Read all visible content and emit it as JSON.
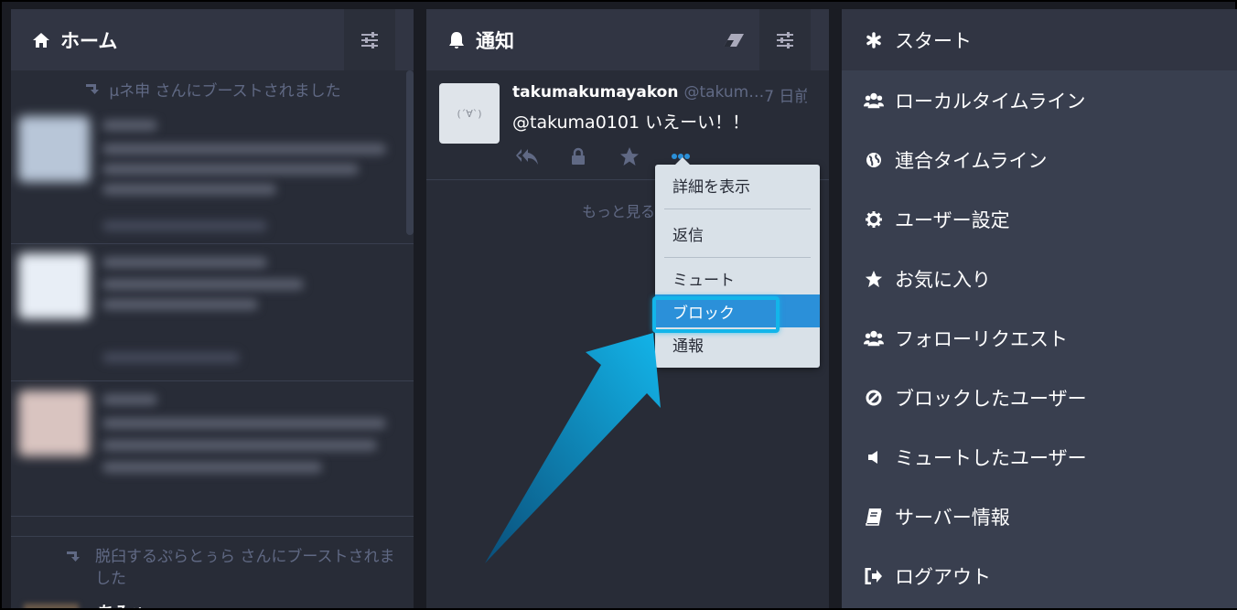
{
  "home_column": {
    "title": "ホーム",
    "boost_note_1": "μネ申 さんにブーストされました",
    "boost_note_2": "脱臼するぷらとぅら さんにブーストされました",
    "peek_name": "ちみゅ"
  },
  "notifications_column": {
    "title": "通知",
    "status": {
      "display_name": "takumakumayakon",
      "acct": "@takum…",
      "time": "7 日前",
      "content": "@takuma0101 いえーい！！",
      "avatar_text": "(´∀`)"
    },
    "load_more": "もっと見る"
  },
  "dropdown": {
    "items": [
      "詳細を表示",
      "返信",
      "ミュート",
      "ブロック",
      "通報"
    ]
  },
  "menu": {
    "items": [
      {
        "label": "スタート",
        "icon": "asterisk-icon"
      },
      {
        "label": "ローカルタイムライン",
        "icon": "users-icon"
      },
      {
        "label": "連合タイムライン",
        "icon": "globe-icon"
      },
      {
        "label": "ユーザー設定",
        "icon": "gear-icon"
      },
      {
        "label": "お気に入り",
        "icon": "star-icon"
      },
      {
        "label": "フォローリクエスト",
        "icon": "users-icon"
      },
      {
        "label": "ブロックしたユーザー",
        "icon": "ban-icon"
      },
      {
        "label": "ミュートしたユーザー",
        "icon": "volume-off-icon"
      },
      {
        "label": "サーバー情報",
        "icon": "book-icon"
      },
      {
        "label": "ログアウト",
        "icon": "sign-out-icon"
      }
    ]
  },
  "colors": {
    "background": "#1a1c23",
    "column": "#282c37",
    "header": "#313543",
    "menu": "#393f4f",
    "accent": "#2b90d9",
    "arrow": "#13b5ea"
  }
}
